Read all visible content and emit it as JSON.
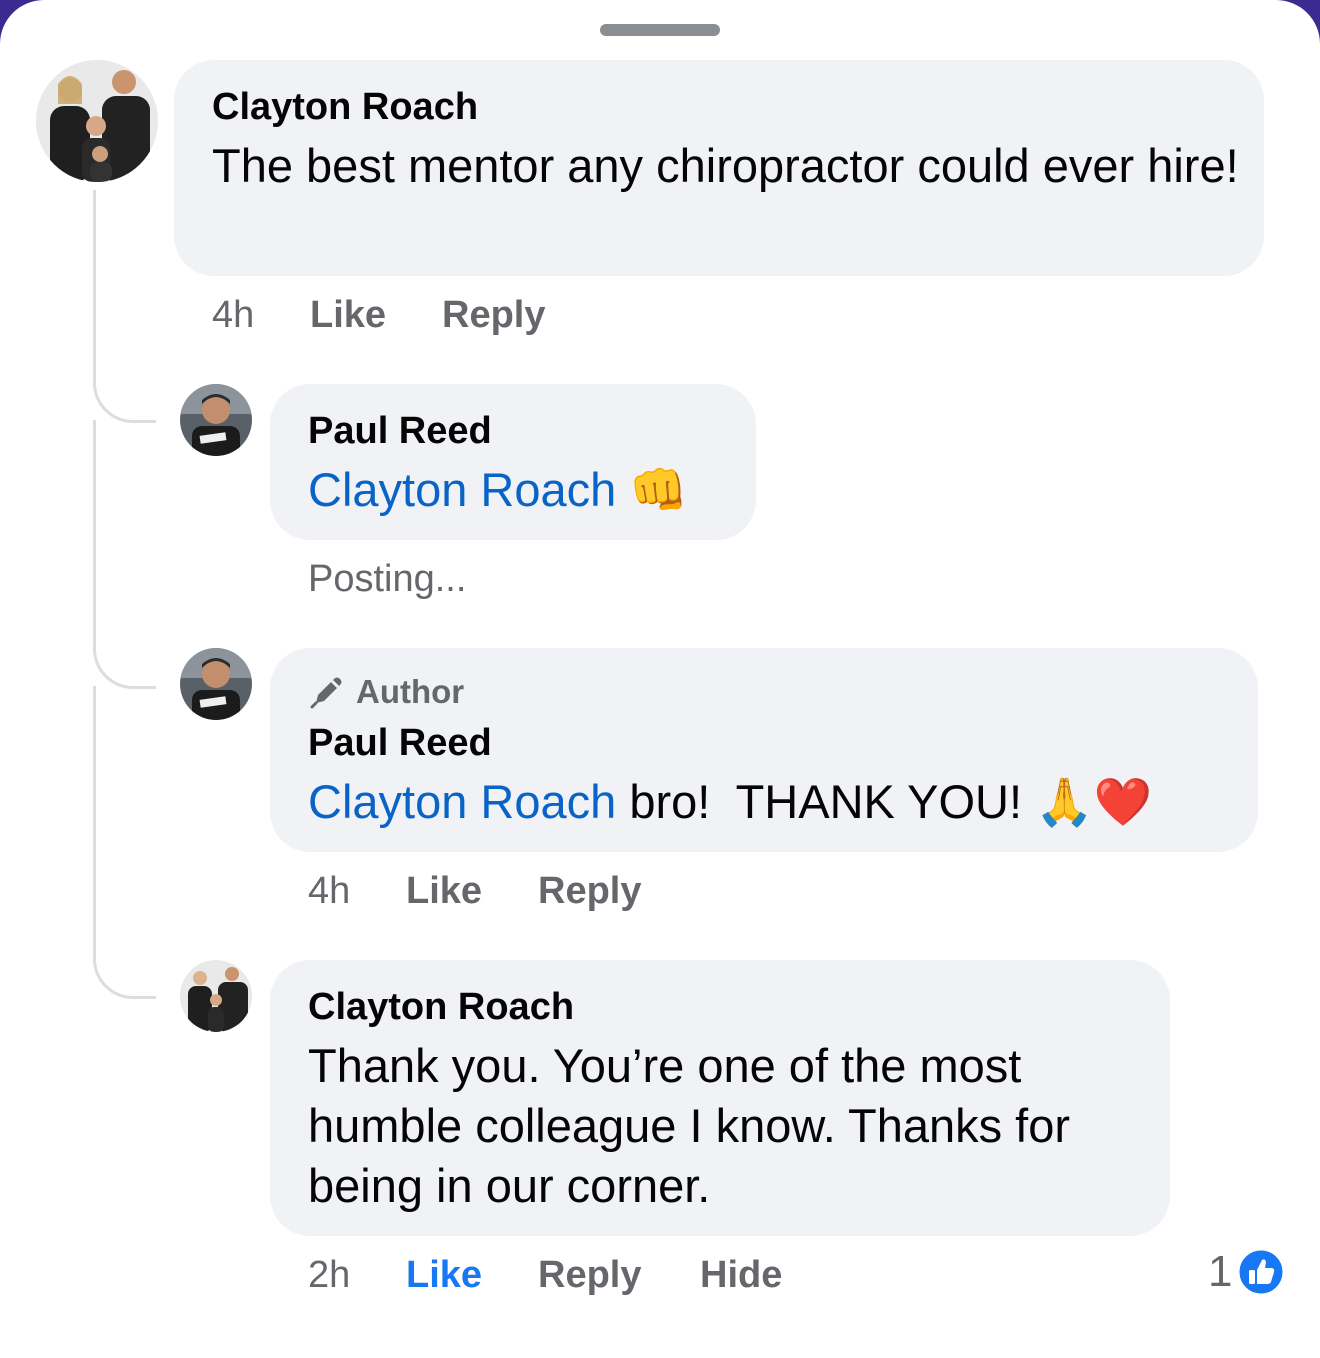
{
  "comment1": {
    "author": "Clayton Roach",
    "text": "The best mentor any chiropractor could ever hire!",
    "time": "4h",
    "like_label": "Like",
    "reply_label": "Reply"
  },
  "reply1": {
    "author": "Paul Reed",
    "mention": "Clayton Roach",
    "emoji": "👊",
    "status": "Posting..."
  },
  "reply2": {
    "badge": "Author",
    "author": "Paul Reed",
    "mention": "Clayton Roach",
    "text": " bro!  THANK YOU! ",
    "emoji": "🙏❤️",
    "time": "4h",
    "like_label": "Like",
    "reply_label": "Reply"
  },
  "reply3": {
    "author": "Clayton Roach",
    "text": "Thank you. You’re one of the most humble colleague I know. Thanks for being in our corner.",
    "time": "2h",
    "like_label": "Like",
    "reply_label": "Reply",
    "hide_label": "Hide",
    "reaction_count": "1"
  },
  "colors": {
    "bubble": "#f0f2f5",
    "mention": "#0a63c7",
    "like_active": "#1877f2",
    "meta": "#65676b"
  }
}
